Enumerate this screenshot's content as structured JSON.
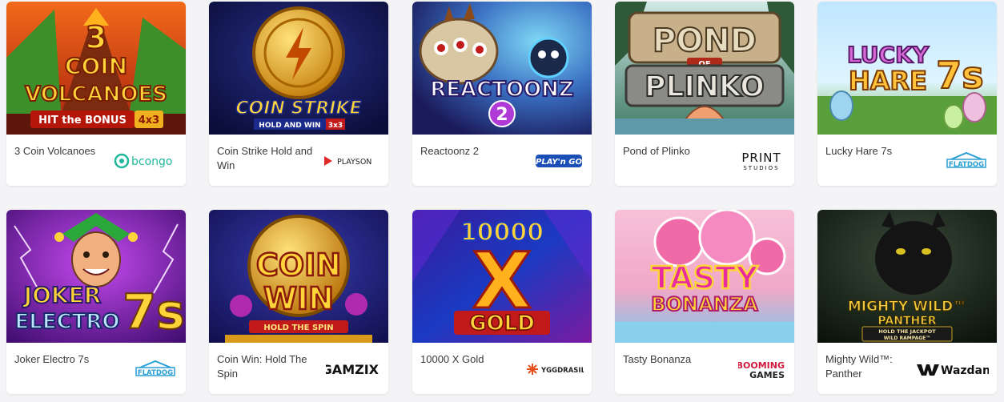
{
  "games": [
    {
      "name": "3 Coin Volcanoes",
      "thumb_lines": [
        "3",
        "COIN",
        "VOLCANOES",
        "HIT the BONUS",
        "4x3"
      ],
      "provider": "bcongo",
      "provider_color": "#1fb89a"
    },
    {
      "name": "Coin Strike Hold and Win",
      "thumb_lines": [
        "COIN STRIKE",
        "HOLD AND WIN",
        "3x3"
      ],
      "provider": "PLAYSON",
      "provider_color": "#222222"
    },
    {
      "name": "Reactoonz 2",
      "thumb_lines": [
        "REACTOONZ",
        "2"
      ],
      "provider": "PLAY'n GO",
      "provider_color": "#1a4fb8"
    },
    {
      "name": "Pond of Plinko",
      "thumb_lines": [
        "POND",
        "OF",
        "PLINKO"
      ],
      "provider": "PRINT",
      "provider_sub": "STUDIOS",
      "provider_color": "#111111"
    },
    {
      "name": "Lucky Hare 7s",
      "thumb_lines": [
        "LUCKY",
        "HARE",
        "7s"
      ],
      "provider": "FLATDOG",
      "provider_color": "#2a9fd6"
    },
    {
      "name": "Joker Electro 7s",
      "thumb_lines": [
        "JOKER",
        "ELECTRO",
        "7s"
      ],
      "provider": "FLATDOG",
      "provider_color": "#2a9fd6"
    },
    {
      "name": "Coin Win: Hold The Spin",
      "thumb_lines": [
        "COIN",
        "WIN",
        "HOLD THE SPIN"
      ],
      "provider": "GAMZIX",
      "provider_color": "#111111"
    },
    {
      "name": "10000 X Gold",
      "thumb_lines": [
        "10000",
        "X",
        "GOLD"
      ],
      "provider": "YGGDRASIL",
      "provider_color": "#e8501e"
    },
    {
      "name": "Tasty Bonanza",
      "thumb_lines": [
        "TASTY",
        "BONANZA"
      ],
      "provider": "BOOMING",
      "provider_sub": "GAMES",
      "provider_color": "#d1193e"
    },
    {
      "name": "Mighty Wild™: Panther",
      "thumb_lines": [
        "MIGHTY",
        "WILD™",
        "PANTHER",
        "HOLD THE JACKPOT",
        "WILD RAMPAGE™"
      ],
      "provider": "Wazdan",
      "provider_color": "#111111"
    }
  ]
}
